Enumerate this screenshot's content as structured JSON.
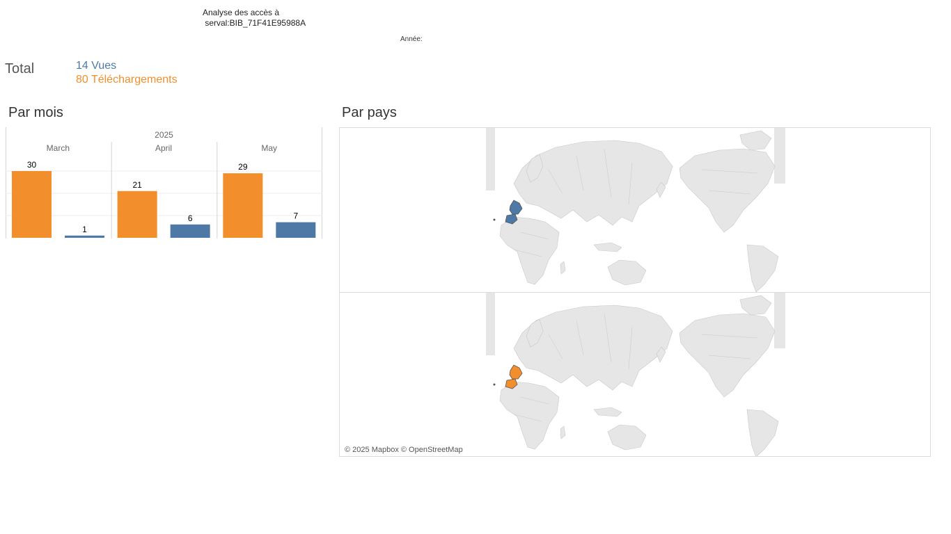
{
  "header": {
    "title_line1": "Analyse des accès à",
    "title_line2": " serval:BIB_71F41E95988A",
    "year_filter_label": "Année:"
  },
  "totals": {
    "label": "Total",
    "views": "14 Vues",
    "downloads": "80 Téléchargements"
  },
  "sections": {
    "by_month": "Par mois",
    "by_country": "Par pays"
  },
  "colors": {
    "downloads": "#f28e2b",
    "views": "#4e79a7",
    "map_land": "#e6e6e6",
    "map_border": "#c8c8c8"
  },
  "chart_data": {
    "type": "bar",
    "year_header": "2025",
    "categories": [
      "March",
      "April",
      "May"
    ],
    "series": [
      {
        "name": "Téléchargements",
        "values": [
          30,
          21,
          29
        ]
      },
      {
        "name": "Vues",
        "values": [
          1,
          6,
          7
        ]
      }
    ],
    "ylim": [
      0,
      30
    ],
    "grid": true
  },
  "maps": {
    "views_highlight": [
      "France",
      "Spain"
    ],
    "downloads_highlight": [
      "France",
      "Spain"
    ],
    "attribution": "© 2025 Mapbox © OpenStreetMap"
  }
}
